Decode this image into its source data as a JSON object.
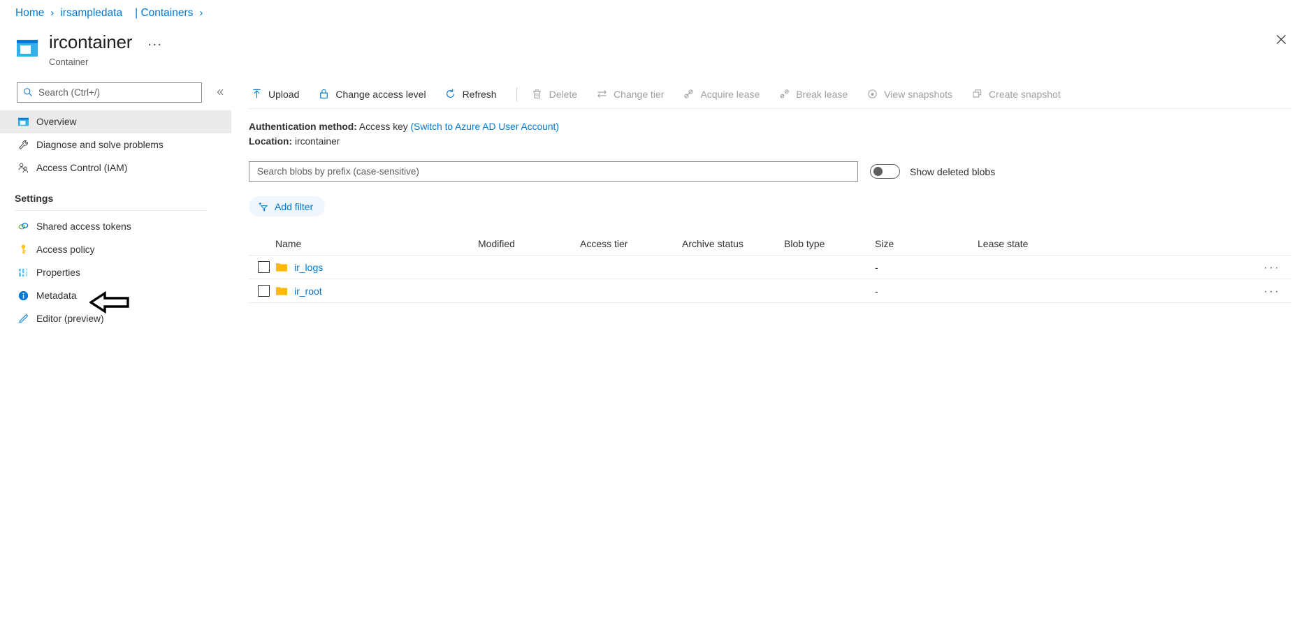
{
  "breadcrumb": {
    "home": "Home",
    "account": "irsampledata",
    "section": "| Containers"
  },
  "header": {
    "title": "ircontainer",
    "subtitle": "Container",
    "ellipsis": "···",
    "close_icon": "close-icon",
    "resource_icon": "container-icon"
  },
  "sidebar": {
    "search_placeholder": "Search (Ctrl+/)",
    "search_value": "",
    "collapse_icon": "double-chevron-left-icon",
    "items": [
      {
        "label": "Overview",
        "icon": "container-icon",
        "selected": true
      },
      {
        "label": "Diagnose and solve problems",
        "icon": "wrench-icon",
        "selected": false
      },
      {
        "label": "Access Control (IAM)",
        "icon": "people-icon",
        "selected": false
      }
    ],
    "section_title": "Settings",
    "settings_items": [
      {
        "label": "Shared access tokens",
        "icon": "link-chain-icon",
        "selected": false
      },
      {
        "label": "Access policy",
        "icon": "key-icon",
        "selected": false
      },
      {
        "label": "Properties",
        "icon": "sliders-icon",
        "selected": false
      },
      {
        "label": "Metadata",
        "icon": "info-icon",
        "selected": false
      },
      {
        "label": "Editor (preview)",
        "icon": "pencil-icon",
        "selected": false
      }
    ],
    "annotation": "left-arrow-annotation"
  },
  "toolbar": {
    "commands": [
      {
        "label": "Upload",
        "icon": "upload-arrow-icon",
        "disabled": false
      },
      {
        "label": "Change access level",
        "icon": "lock-icon",
        "disabled": false
      },
      {
        "label": "Refresh",
        "icon": "refresh-icon",
        "disabled": false
      },
      {
        "label": "Delete",
        "icon": "trash-icon",
        "disabled": true
      },
      {
        "label": "Change tier",
        "icon": "swap-arrows-icon",
        "disabled": true
      },
      {
        "label": "Acquire lease",
        "icon": "plug-icon",
        "disabled": true
      },
      {
        "label": "Break lease",
        "icon": "unplug-icon",
        "disabled": true
      },
      {
        "label": "View snapshots",
        "icon": "snapshot-eye-icon",
        "disabled": true
      },
      {
        "label": "Create snapshot",
        "icon": "copy-windows-icon",
        "disabled": true
      }
    ]
  },
  "info": {
    "auth_label": "Authentication method:",
    "auth_value": "Access key",
    "auth_link": "(Switch to Azure AD User Account)",
    "location_label": "Location:",
    "location_value": "ircontainer"
  },
  "filters": {
    "blob_search_placeholder": "Search blobs by prefix (case-sensitive)",
    "blob_search_value": "",
    "show_deleted_label": "Show deleted blobs",
    "show_deleted_on": false,
    "add_filter_label": "Add filter",
    "add_filter_icon": "add-filter-funnel-icon"
  },
  "table": {
    "columns": [
      "Name",
      "Modified",
      "Access tier",
      "Archive status",
      "Blob type",
      "Size",
      "Lease state"
    ],
    "rows": [
      {
        "name": "ir_logs",
        "icon": "folder-icon",
        "modified": "",
        "access_tier": "",
        "archive_status": "",
        "blob_type": "",
        "size": "-",
        "lease_state": "",
        "menu": "···"
      },
      {
        "name": "ir_root",
        "icon": "folder-icon",
        "modified": "",
        "access_tier": "",
        "archive_status": "",
        "blob_type": "",
        "size": "-",
        "lease_state": "",
        "menu": "···"
      }
    ]
  },
  "colors": {
    "accent": "#0078d4",
    "folder": "#ffb900",
    "selected_row_bg": "#edebe9",
    "disabled_text": "#a19f9d"
  }
}
